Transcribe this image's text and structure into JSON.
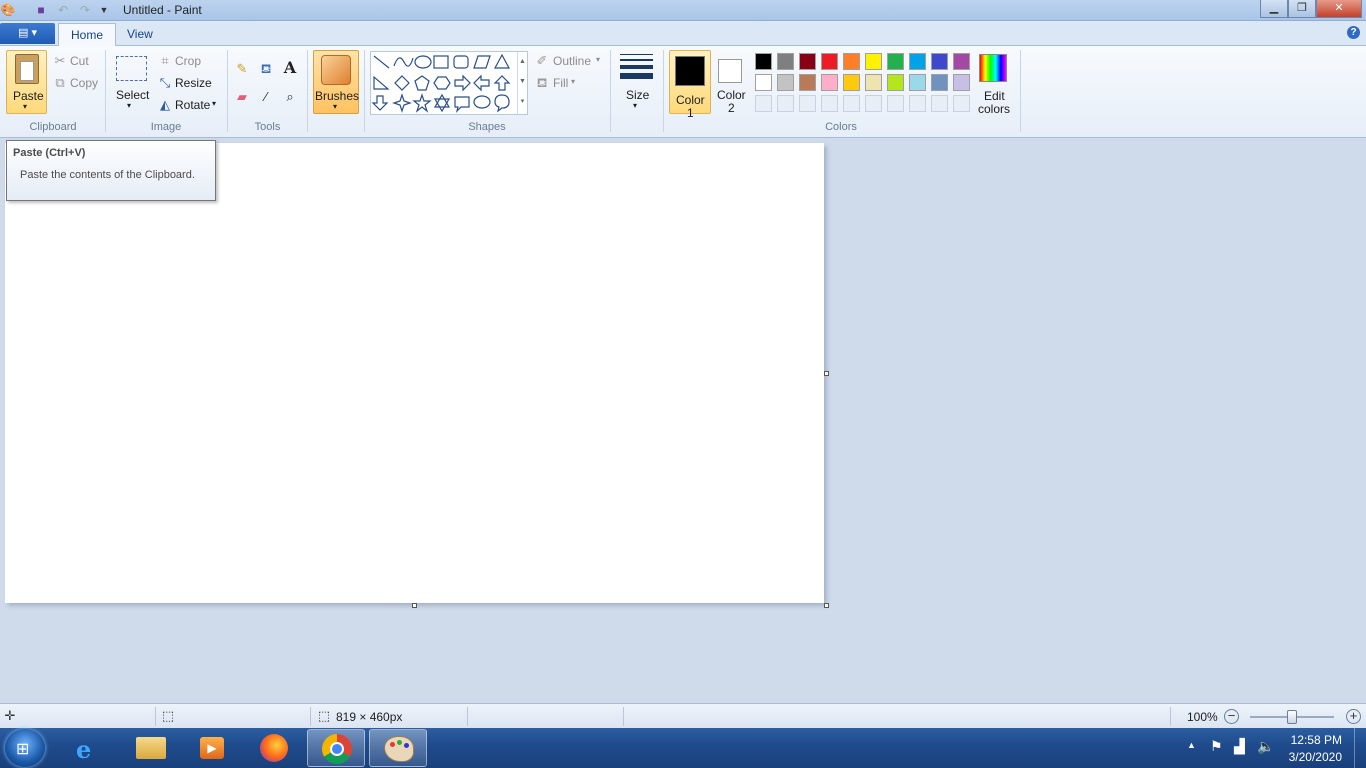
{
  "window": {
    "title": "Untitled - Paint",
    "min_icon": "minimize-icon",
    "max_icon": "restore-icon",
    "close_icon": "close-icon"
  },
  "tabs": {
    "home": "Home",
    "view": "View"
  },
  "clipboard": {
    "paste": "Paste",
    "cut": "Cut",
    "copy": "Copy",
    "group": "Clipboard"
  },
  "image": {
    "select": "Select",
    "crop": "Crop",
    "resize": "Resize",
    "rotate": "Rotate",
    "group": "Image"
  },
  "tools": {
    "group": "Tools"
  },
  "brushes": {
    "label": "Brushes"
  },
  "shapes": {
    "outline": "Outline",
    "fill": "Fill",
    "group": "Shapes"
  },
  "size": {
    "label": "Size"
  },
  "colors": {
    "color1_line1": "Color",
    "color1_line2": "1",
    "color2_line1": "Color",
    "color2_line2": "2",
    "edit_line1": "Edit",
    "edit_line2": "colors",
    "group": "Colors",
    "color1_value": "#000000",
    "color2_value": "#ffffff",
    "palette_row1": [
      "#000000",
      "#7f7f7f",
      "#880015",
      "#ed1c24",
      "#ff7f27",
      "#fff200",
      "#22b14c",
      "#00a2e8",
      "#3f48cc",
      "#a349a4"
    ],
    "palette_row2": [
      "#ffffff",
      "#c3c3c3",
      "#b97a57",
      "#ffaec9",
      "#ffc90e",
      "#efe4b0",
      "#b5e61d",
      "#99d9ea",
      "#7092be",
      "#c8bfe7"
    ]
  },
  "tooltip": {
    "title": "Paste (Ctrl+V)",
    "body": "Paste the contents of the Clipboard."
  },
  "status": {
    "dimensions": "819 × 460px",
    "zoom": "100%"
  },
  "taskbar": {
    "time": "12:58 PM",
    "date": "3/20/2020"
  }
}
